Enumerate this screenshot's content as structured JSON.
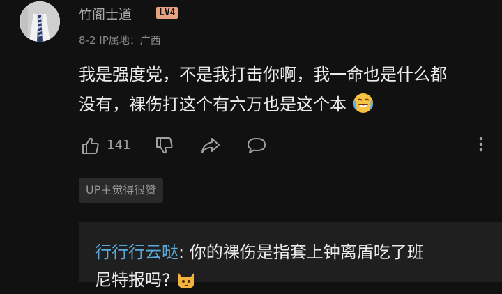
{
  "comment": {
    "username": "竹阁士道",
    "level": "LV4",
    "date": "8-2",
    "ip_location": "IP属地：广西",
    "text_line1": "我是强度党，不是我打击你啊，我一命也是什么都",
    "text_line2": "没有，裸伤打这个有六万也是这个本",
    "emoji": "crying-laughing-emoji",
    "like_count": "141",
    "up_badge": "UP主觉得很赞"
  },
  "reply": {
    "username": "行行行云哒",
    "separator": ":",
    "text_line1": " 你的裸伤是指套上钟离盾吃了班",
    "text_line2": "尼特报吗?",
    "emoji": "cat-emoji"
  },
  "colors": {
    "background": "#111111",
    "reply_bg": "#1f1f1f",
    "link_blue": "#5aa9d8",
    "level_badge": "#e7a27f"
  },
  "icons": [
    "thumbs-up-icon",
    "thumbs-down-icon",
    "share-icon",
    "comment-icon",
    "more-vertical-icon"
  ]
}
